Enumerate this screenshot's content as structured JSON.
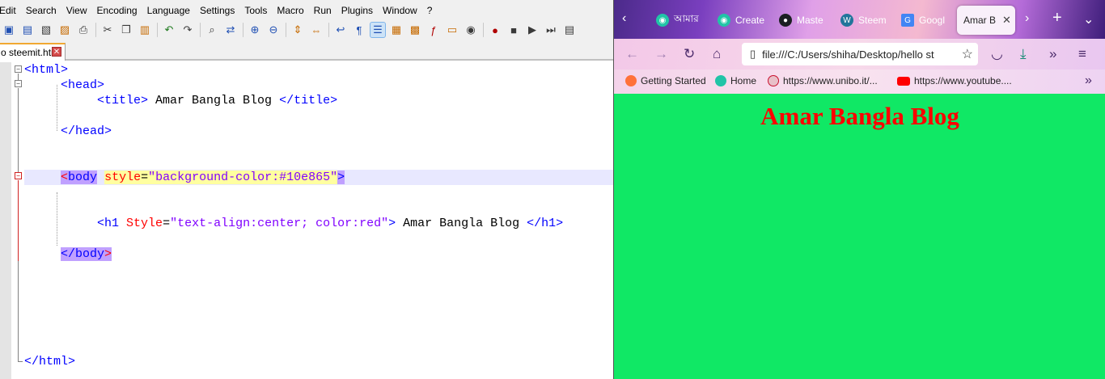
{
  "editor": {
    "menu": [
      "Edit",
      "Search",
      "View",
      "Encoding",
      "Language",
      "Settings",
      "Tools",
      "Macro",
      "Run",
      "Plugins",
      "Window",
      "?"
    ],
    "tab": {
      "label": "o steemit.html",
      "close": "✕"
    },
    "code": {
      "html_open": "<html>",
      "head_open": "<head>",
      "title_open": "<title>",
      "title_text": " Amar Bangla Blog ",
      "title_close": "</title>",
      "head_close": "</head>",
      "body_lt": "<",
      "body_tag": "body",
      "body_space": " ",
      "body_attr": "style",
      "body_eq": "=",
      "body_val": "\"background-color:#10e865\"",
      "body_gt": ">",
      "h1_open": "<h1",
      "h1_attr": "Style",
      "h1_eq": "=",
      "h1_val": "\"text-align:center; color:red\"",
      "h1_gt": ">",
      "h1_text": " Amar Bangla Blog ",
      "h1_close": "</h1>",
      "body_close_pre": "</body",
      "body_close_gt": ">",
      "html_close": "</html>"
    },
    "fold_marks": {
      "minus": "−"
    }
  },
  "browser": {
    "tabs": [
      {
        "label": "আমার",
        "icon": "steemit-icon",
        "color": "#21c4a7"
      },
      {
        "label": "Create",
        "icon": "steemit-icon",
        "color": "#21c4a7"
      },
      {
        "label": "Maste",
        "icon": "github-icon",
        "color": "#1b1f23"
      },
      {
        "label": "Steem",
        "icon": "wordpress-icon",
        "color": "#21759b"
      },
      {
        "label": "Googl",
        "icon": "google-translate-icon",
        "color": "#4285f4"
      }
    ],
    "active_tab": {
      "label": "Amar B",
      "close": "✕"
    },
    "url": "file:///C:/Users/shiha/Desktop/hello st",
    "bookmarks": [
      {
        "label": "Getting Started",
        "icon": "firefox-icon",
        "color": "#ff7139"
      },
      {
        "label": "Home",
        "icon": "steemit-icon",
        "color": "#21c4a7"
      },
      {
        "label": "https://www.unibo.it/...",
        "icon": "unibo-icon",
        "color": "#c8102e"
      },
      {
        "label": "https://www.youtube....",
        "icon": "youtube-icon",
        "color": "#ff0000"
      }
    ],
    "page": {
      "heading": "Amar Bangla Blog",
      "background_color": "#10e865",
      "heading_color": "#ff0000"
    }
  }
}
